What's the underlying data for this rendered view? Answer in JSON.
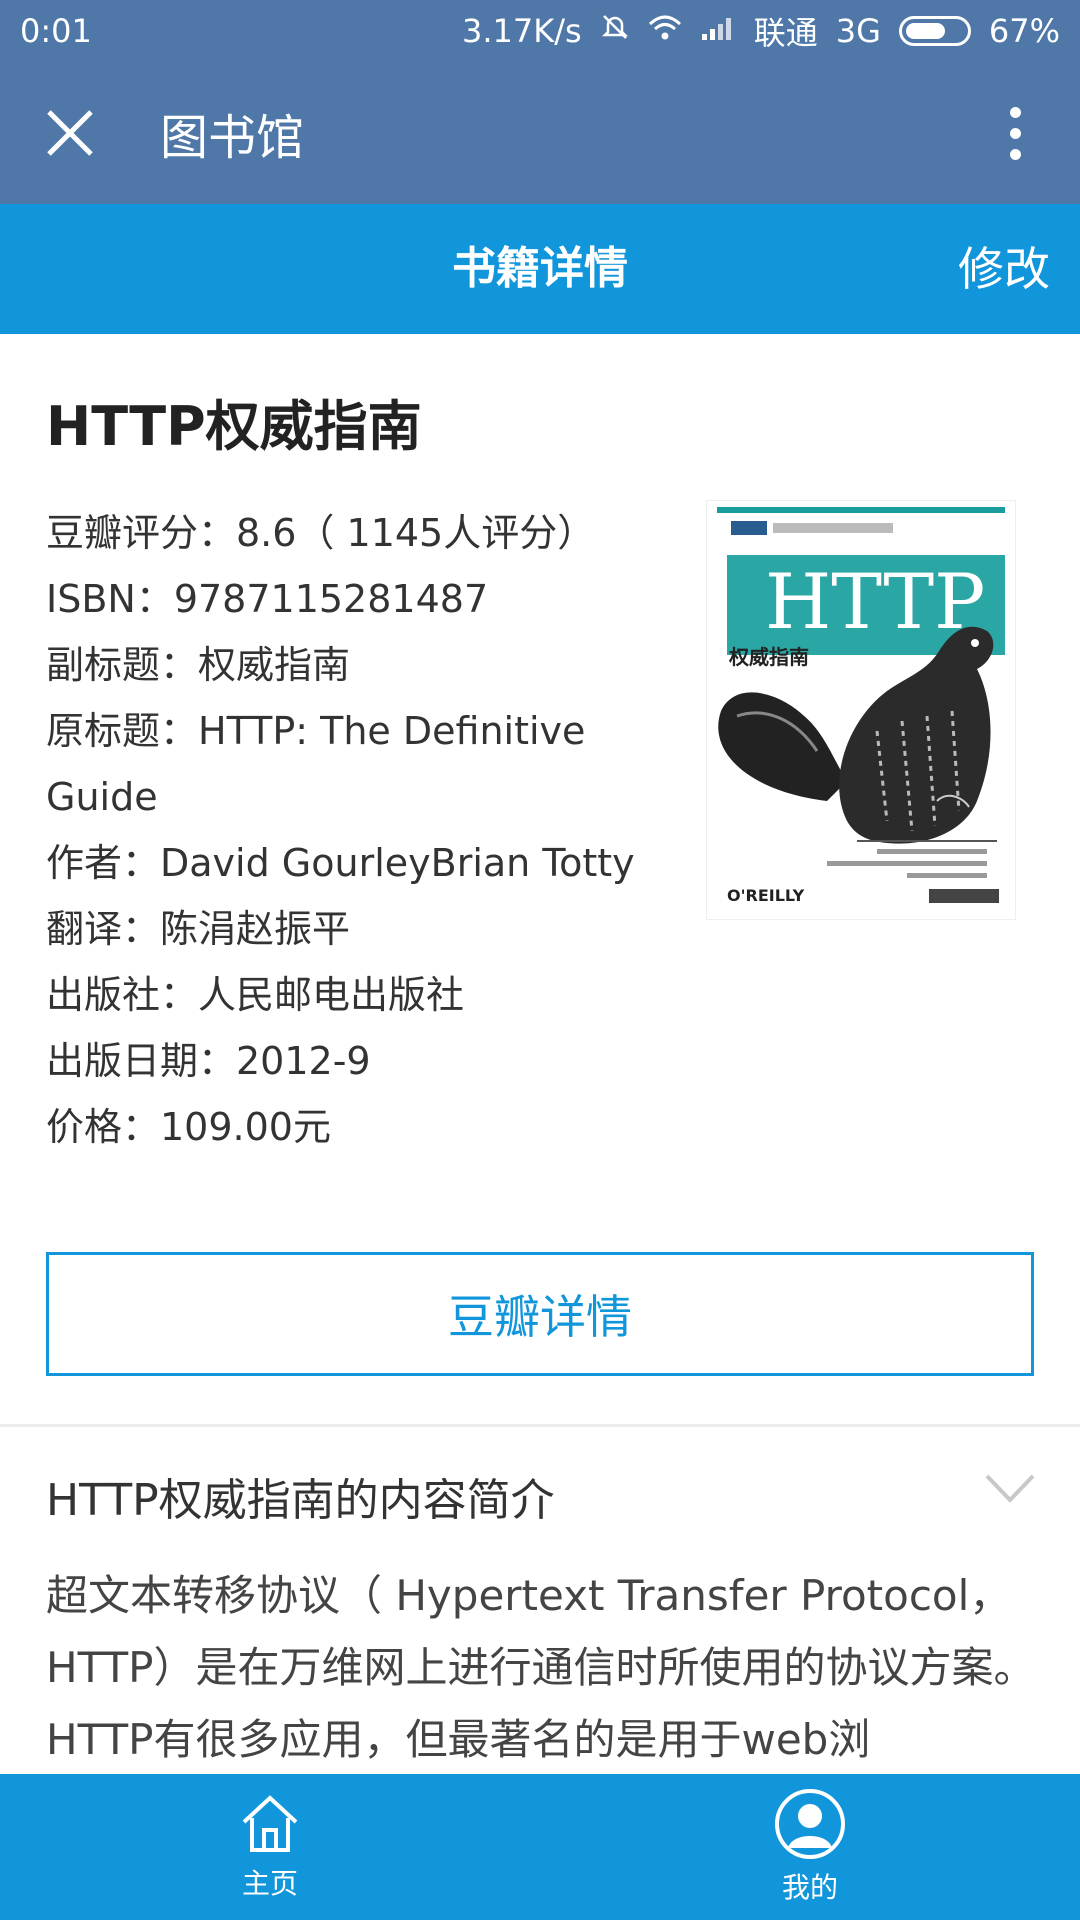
{
  "status_bar": {
    "time": "0:01",
    "speed": "3.17K/s",
    "carrier": "联通",
    "network": "3G",
    "battery": "67%",
    "battery_level": 0.67
  },
  "title_bar": {
    "title": "图书馆",
    "close_icon": "close-icon",
    "more_icon": "more-vertical-icon"
  },
  "header": {
    "title": "书籍详情",
    "edit_label": "修改"
  },
  "book": {
    "title": "HTTP权威指南",
    "rating": "豆瓣评分：8.6（ 1145人评分）",
    "isbn": "ISBN：9787115281487",
    "subtitle": "副标题：权威指南",
    "original_title": "原标题：HTTP: The Definitive Guide",
    "author": "作者：David GourleyBrian Totty",
    "translator": "翻译：陈涓赵振平",
    "publisher": "出版社：人民邮电出版社",
    "publish_date": "出版日期：2012-9",
    "price": "价格：109.00元",
    "cover": {
      "brand_text": "HTTP",
      "sub_text": "权威指南",
      "publisher_logo": "O'REILLY"
    }
  },
  "douban_button": "豆瓣详情",
  "intro": {
    "heading": "HTTP权威指南的内容简介",
    "text": "超文本转移协议（ Hypertext Transfer Protocol，HTTP）是在万维网上进行通信时所使用的协议方案。HTTP有很多应用，但最著名的是用于web浏"
  },
  "tabs": [
    {
      "label": "主页",
      "icon": "home-icon"
    },
    {
      "label": "我的",
      "icon": "user-icon"
    }
  ],
  "colors": {
    "title_bar": "#4f77a8",
    "accent": "#1296db"
  }
}
